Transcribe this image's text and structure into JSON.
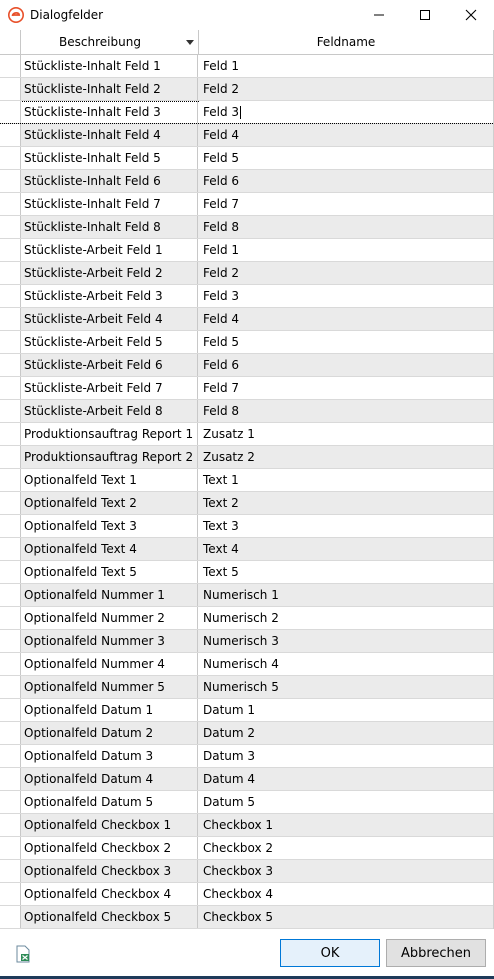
{
  "window": {
    "title": "Dialogfelder",
    "minimize_glyph": "—",
    "maximize_glyph": "☐",
    "close_glyph": "✕"
  },
  "grid": {
    "columns": [
      "Beschreibung",
      "Feldname"
    ],
    "sort_column": "Beschreibung",
    "selected_row_index": 2,
    "rows": [
      [
        "Stückliste-Inhalt Feld 1",
        "Feld 1"
      ],
      [
        "Stückliste-Inhalt Feld 2",
        "Feld 2"
      ],
      [
        "Stückliste-Inhalt Feld 3",
        "Feld 3"
      ],
      [
        "Stückliste-Inhalt Feld 4",
        "Feld 4"
      ],
      [
        "Stückliste-Inhalt Feld 5",
        "Feld 5"
      ],
      [
        "Stückliste-Inhalt Feld 6",
        "Feld 6"
      ],
      [
        "Stückliste-Inhalt Feld 7",
        "Feld 7"
      ],
      [
        "Stückliste-Inhalt Feld 8",
        "Feld 8"
      ],
      [
        "Stückliste-Arbeit Feld 1",
        "Feld 1"
      ],
      [
        "Stückliste-Arbeit Feld 2",
        "Feld 2"
      ],
      [
        "Stückliste-Arbeit Feld 3",
        "Feld 3"
      ],
      [
        "Stückliste-Arbeit Feld 4",
        "Feld 4"
      ],
      [
        "Stückliste-Arbeit Feld 5",
        "Feld 5"
      ],
      [
        "Stückliste-Arbeit Feld 6",
        "Feld 6"
      ],
      [
        "Stückliste-Arbeit Feld 7",
        "Feld 7"
      ],
      [
        "Stückliste-Arbeit Feld 8",
        "Feld 8"
      ],
      [
        "Produktionsauftrag Report 1",
        "Zusatz 1"
      ],
      [
        "Produktionsauftrag Report 2",
        "Zusatz 2"
      ],
      [
        "Optionalfeld Text 1",
        "Text 1"
      ],
      [
        "Optionalfeld Text 2",
        "Text 2"
      ],
      [
        "Optionalfeld Text 3",
        "Text 3"
      ],
      [
        "Optionalfeld Text 4",
        "Text 4"
      ],
      [
        "Optionalfeld Text 5",
        "Text 5"
      ],
      [
        "Optionalfeld Nummer 1",
        "Numerisch 1"
      ],
      [
        "Optionalfeld Nummer 2",
        "Numerisch 2"
      ],
      [
        "Optionalfeld Nummer 3",
        "Numerisch 3"
      ],
      [
        "Optionalfeld Nummer 4",
        "Numerisch 4"
      ],
      [
        "Optionalfeld Nummer 5",
        "Numerisch 5"
      ],
      [
        "Optionalfeld Datum 1",
        "Datum 1"
      ],
      [
        "Optionalfeld Datum 2",
        "Datum 2"
      ],
      [
        "Optionalfeld Datum 3",
        "Datum 3"
      ],
      [
        "Optionalfeld Datum 4",
        "Datum 4"
      ],
      [
        "Optionalfeld Datum 5",
        "Datum 5"
      ],
      [
        "Optionalfeld Checkbox 1",
        "Checkbox 1"
      ],
      [
        "Optionalfeld Checkbox 2",
        "Checkbox 2"
      ],
      [
        "Optionalfeld Checkbox 3",
        "Checkbox 3"
      ],
      [
        "Optionalfeld Checkbox 4",
        "Checkbox 4"
      ],
      [
        "Optionalfeld Checkbox 5",
        "Checkbox 5"
      ]
    ]
  },
  "footer": {
    "excel_icon": "excel-export-icon",
    "ok_label": "OK",
    "cancel_label": "Abbrechen"
  },
  "colors": {
    "row_alt": "#ebebeb",
    "accent": "#0078d7",
    "app_icon": "#e8502a"
  }
}
